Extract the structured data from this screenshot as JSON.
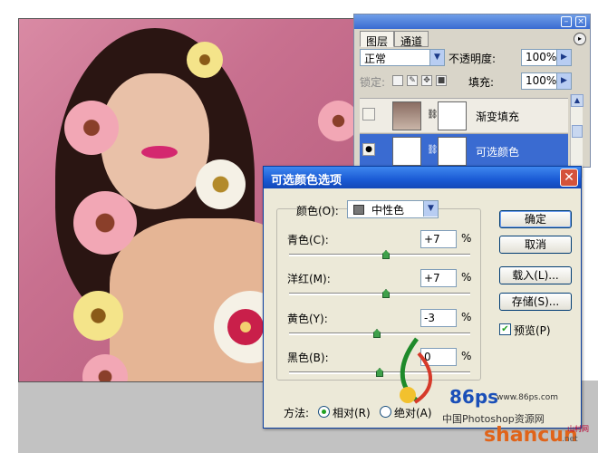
{
  "layers_panel": {
    "tabs": [
      "图层",
      "通道"
    ],
    "blend_mode": "正常",
    "opacity_label": "不透明度:",
    "opacity_value": "100%",
    "lock_label": "锁定:",
    "fill_label": "填充:",
    "fill_value": "100%",
    "layers": [
      {
        "name": "渐变填充",
        "visible": false,
        "selected": false
      },
      {
        "name": "可选颜色",
        "visible": true,
        "selected": true
      }
    ]
  },
  "dialog": {
    "title": "可选颜色选项",
    "color_label": "颜色(O):",
    "color_value": "中性色",
    "sliders": [
      {
        "label": "青色(C):",
        "value": "+7",
        "unit": "%",
        "position": 0.535
      },
      {
        "label": "洋红(M):",
        "value": "+7",
        "unit": "%",
        "position": 0.535
      },
      {
        "label": "黄色(Y):",
        "value": "-3",
        "unit": "%",
        "position": 0.485
      },
      {
        "label": "黑色(B):",
        "value": "0",
        "unit": "%",
        "position": 0.5
      }
    ],
    "buttons": {
      "ok": "确定",
      "cancel": "取消",
      "load": "载入(L)...",
      "save": "存储(S)..."
    },
    "preview_label": "预览(P)",
    "preview_checked": true,
    "method_label": "方法:",
    "method_options": [
      "相对(R)",
      "绝对(A)"
    ],
    "method_selected": 0
  },
  "watermark": {
    "brand": "86ps",
    "url": "www.86ps.com",
    "tagline": "中国Photoshop资源网",
    "site": "shancun",
    "site_suffix": ".net",
    "site_cn": "山村网"
  },
  "colors": {
    "titlebar": "#1a5ad4",
    "selection": "#3a6bd1",
    "dialog_bg": "#ece9d8",
    "slider_knob": "#3fa04a"
  }
}
